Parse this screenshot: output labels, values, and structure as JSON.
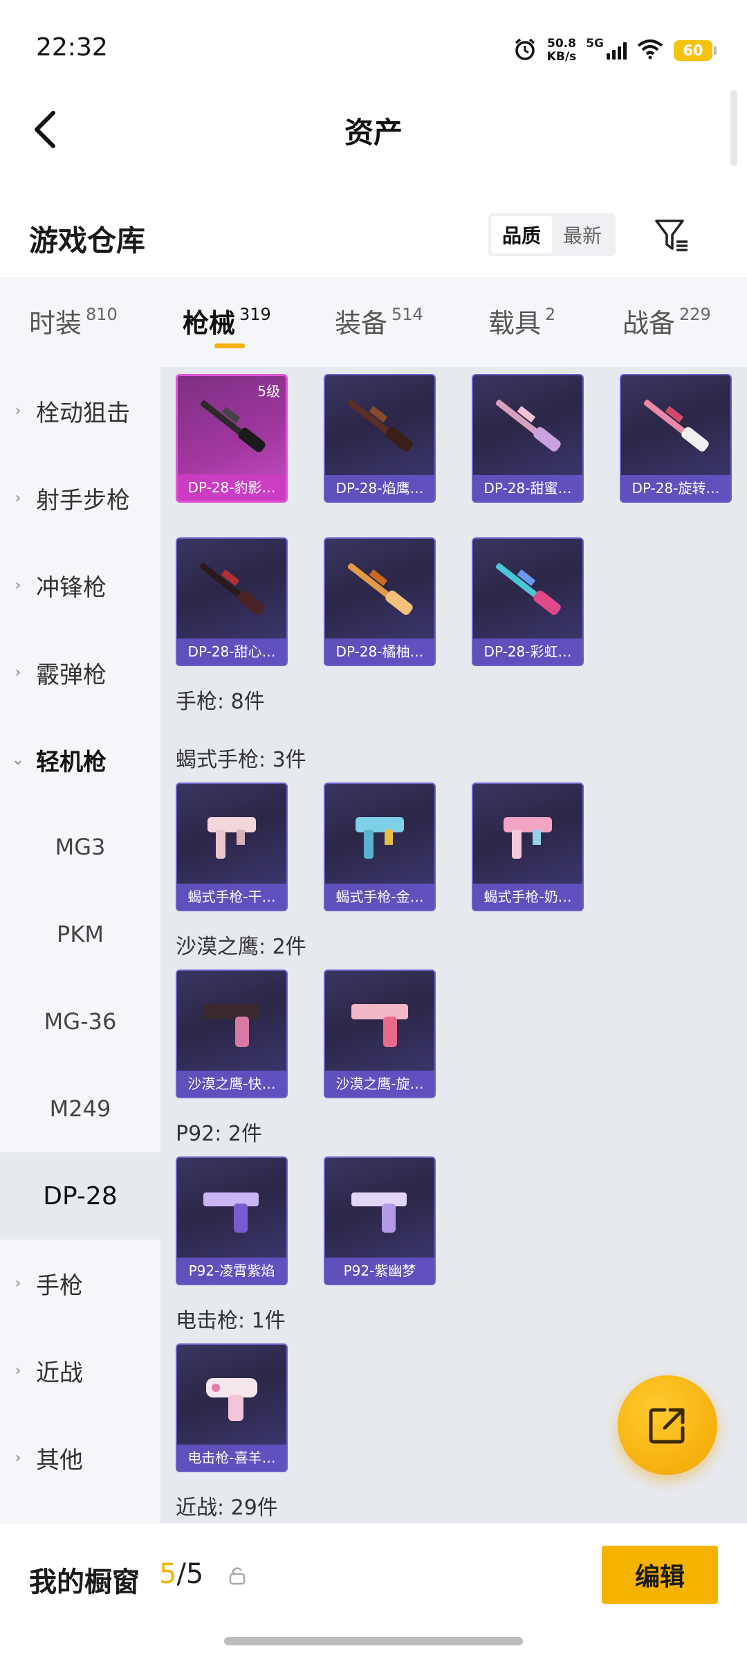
{
  "status": {
    "time": "22:32",
    "speed_value": "50.8",
    "speed_unit": "KB/s",
    "network": "5G",
    "battery": "60"
  },
  "header": {
    "title": "资产"
  },
  "section": {
    "title": "游戏仓库",
    "sort_options": [
      "品质",
      "最新"
    ],
    "active_sort": "品质"
  },
  "tabs": [
    {
      "label": "时装",
      "count": "810"
    },
    {
      "label": "枪械",
      "count": "319"
    },
    {
      "label": "装备",
      "count": "514"
    },
    {
      "label": "载具",
      "count": "2"
    },
    {
      "label": "战备",
      "count": "229"
    }
  ],
  "active_tab": "枪械",
  "sidebar": {
    "categories": [
      {
        "label": "栓动狙击",
        "expanded": false
      },
      {
        "label": "射手步枪",
        "expanded": false
      },
      {
        "label": "冲锋枪",
        "expanded": false
      },
      {
        "label": "霰弹枪",
        "expanded": false
      },
      {
        "label": "轻机枪",
        "expanded": true
      }
    ],
    "subcategories": [
      "MG3",
      "PKM",
      "MG-36",
      "M249",
      "DP-28"
    ],
    "active_subcategory": "DP-28",
    "more_categories": [
      {
        "label": "手枪",
        "expanded": false
      },
      {
        "label": "近战",
        "expanded": false
      },
      {
        "label": "其他",
        "expanded": false
      }
    ]
  },
  "items": {
    "dp28": [
      {
        "name": "DP-28-豹影…",
        "level": "5级",
        "rarity": "legendary"
      },
      {
        "name": "DP-28-焰鹰…"
      },
      {
        "name": "DP-28-甜蜜…"
      },
      {
        "name": "DP-28-旋转…"
      },
      {
        "name": "DP-28-甜心…"
      },
      {
        "name": "DP-28-橘柚…"
      },
      {
        "name": "DP-28-彩虹…"
      }
    ],
    "groups": [
      {
        "label": "手枪: 8件"
      },
      {
        "label": "蝎式手枪: 3件"
      },
      {
        "label": "沙漠之鹰: 2件"
      },
      {
        "label": "P92: 2件"
      },
      {
        "label": "电击枪: 1件"
      },
      {
        "label": "近战: 29件"
      }
    ],
    "scorpion": [
      {
        "name": "蝎式手枪-干…"
      },
      {
        "name": "蝎式手枪-金…"
      },
      {
        "name": "蝎式手枪-奶…"
      }
    ],
    "deagle": [
      {
        "name": "沙漠之鹰-快…"
      },
      {
        "name": "沙漠之鹰-旋…"
      }
    ],
    "p92": [
      {
        "name": "P92-凌霄紫焰"
      },
      {
        "name": "P92-紫幽梦"
      }
    ],
    "taser": [
      {
        "name": "电击枪-喜羊…"
      }
    ]
  },
  "bottom": {
    "label": "我的橱窗",
    "count_current": "5",
    "count_sep": "/5",
    "edit_label": "编辑"
  },
  "colors": {
    "accent": "#f5b300",
    "card_border": "#6b62c8",
    "legendary": "#c74fc6"
  },
  "icons": [
    "back-arrow-icon",
    "filter-icon",
    "share-external-icon",
    "lock-icon",
    "alarm-icon",
    "wifi-icon",
    "signal-icon",
    "battery-icon"
  ]
}
